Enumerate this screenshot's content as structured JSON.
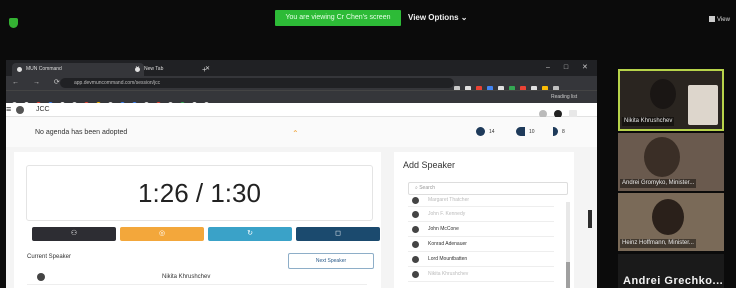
{
  "zoom": {
    "banner": "You are viewing Cr Chen's screen",
    "view_options": "View Options",
    "view_button": "View"
  },
  "browser": {
    "tabs": [
      {
        "label": "MUN Command"
      },
      {
        "label": "New Tab"
      }
    ],
    "url": "app.devmuncommand.com/session/jcc",
    "reading_list": "Reading list"
  },
  "app": {
    "committee": "JCC",
    "agenda": "No agenda has been adopted",
    "stats": [
      {
        "value": "14"
      },
      {
        "value": "10"
      },
      {
        "value": "8"
      }
    ],
    "timer": "1:26 / 1:30",
    "controls": [
      {
        "name": "speakers",
        "color": "#2d2d33"
      },
      {
        "name": "pause",
        "color": "#f3a73b"
      },
      {
        "name": "reset",
        "color": "#3aa2c8"
      },
      {
        "name": "stop",
        "color": "#1b4a6e"
      }
    ],
    "current_speaker_label": "Current Speaker",
    "next_speaker": "Next Speaker",
    "current_speaker": "Nikita Khrushchev",
    "add_speaker": {
      "title": "Add Speaker",
      "search_placeholder": "Search",
      "list": [
        {
          "name": "Margaret Thatcher",
          "faded": true
        },
        {
          "name": "John F. Kennedy",
          "faded": true
        },
        {
          "name": "John McCone",
          "faded": false
        },
        {
          "name": "Konrad Adenauer",
          "faded": false
        },
        {
          "name": "Lord Mountbatten",
          "faded": false
        },
        {
          "name": "Nikita Khrushchev",
          "faded": true
        }
      ]
    }
  },
  "participants": [
    {
      "name": "Nikita Khrushchev"
    },
    {
      "name": "Andrei Gromyko, Minister..."
    },
    {
      "name": "Heinz Hoffmann, Minister..."
    },
    {
      "name": "Andrei  Grechko..."
    }
  ]
}
